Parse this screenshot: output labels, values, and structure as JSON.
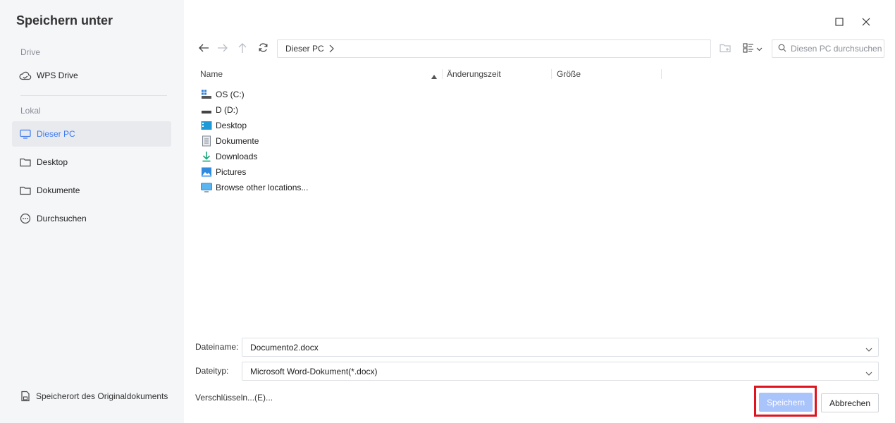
{
  "dialog": {
    "title": "Speichern unter"
  },
  "sidebar": {
    "section_drive": "Drive",
    "drive_items": [
      {
        "label": "WPS Drive",
        "icon": "cloud-icon"
      }
    ],
    "section_local": "Lokal",
    "local_items": [
      {
        "label": "Dieser PC",
        "icon": "monitor-icon",
        "active": true
      },
      {
        "label": "Desktop",
        "icon": "folder-icon",
        "active": false
      },
      {
        "label": "Dokumente",
        "icon": "folder-icon",
        "active": false
      },
      {
        "label": "Durchsuchen",
        "icon": "more-circle-icon",
        "active": false
      }
    ],
    "bottom_item": {
      "label": "Speicherort des Originaldokuments",
      "icon": "document-location-icon"
    }
  },
  "toolbar": {
    "breadcrumb": "Dieser PC",
    "search_placeholder": "Diesen PC durchsuchen"
  },
  "file_list": {
    "columns": [
      "Name",
      "Änderungszeit",
      "Größe"
    ],
    "sort_column": "Name",
    "sort_direction": "ascending",
    "items": [
      {
        "name": "OS (C:)",
        "icon": "windows-drive-icon"
      },
      {
        "name": "D (D:)",
        "icon": "drive-icon"
      },
      {
        "name": "Desktop",
        "icon": "desktop-folder-icon"
      },
      {
        "name": "Dokumente",
        "icon": "documents-icon"
      },
      {
        "name": "Downloads",
        "icon": "download-icon"
      },
      {
        "name": "Pictures",
        "icon": "pictures-icon"
      },
      {
        "name": "Browse other locations...",
        "icon": "monitor-icon"
      }
    ]
  },
  "form": {
    "filename_label": "Dateiname:",
    "filename_value": "Documento2.docx",
    "filetype_label": "Dateityp:",
    "filetype_value": "Microsoft Word-Dokument(*.docx)",
    "encrypt_label": "Verschlüsseln...(E)...",
    "save_label": "Speichern",
    "cancel_label": "Abbrechen"
  },
  "colors": {
    "accent": "#3d7af2",
    "save_button_disabled": "#a9c3fb",
    "highlight": "#e0141e"
  }
}
